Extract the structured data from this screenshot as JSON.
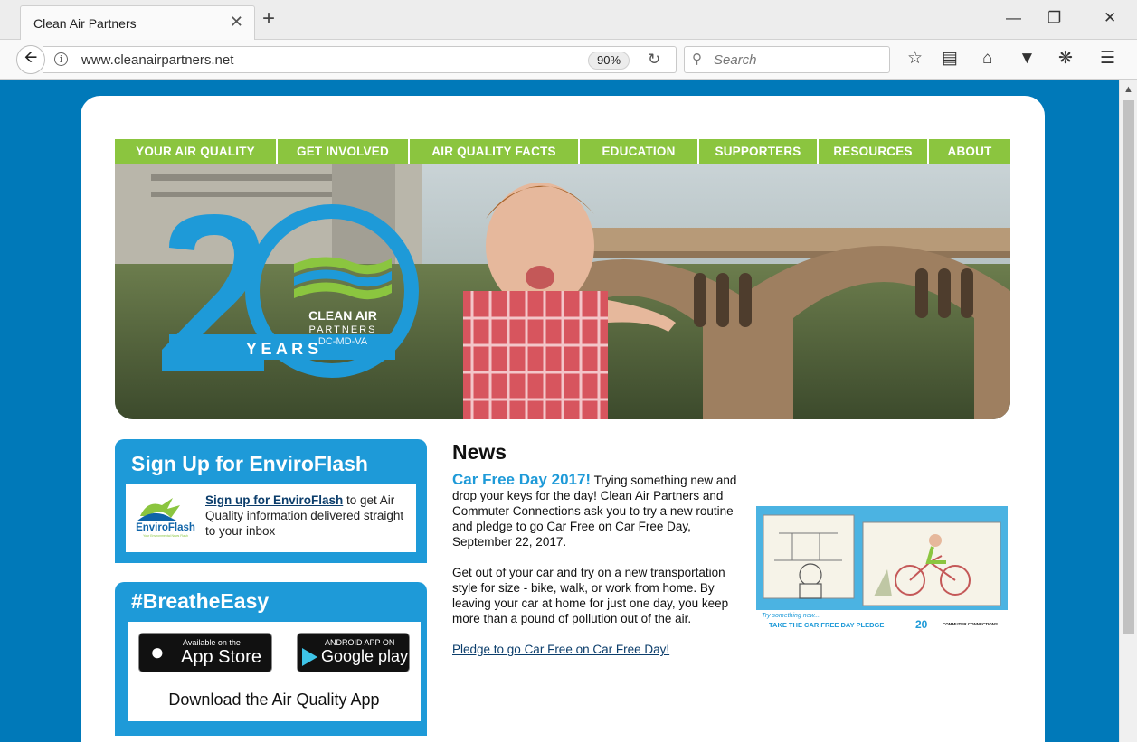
{
  "browser": {
    "tab_title": "Clean Air Partners",
    "tab_close": "✕",
    "new_tab": "+",
    "url": "www.cleanairpartners.net",
    "zoom": "90%",
    "search_placeholder": "Search",
    "window_controls": [
      "minimize",
      "restore",
      "close"
    ]
  },
  "site": {
    "nav": [
      "YOUR AIR QUALITY",
      "GET INVOLVED",
      "AIR QUALITY FACTS",
      "EDUCATION",
      "SUPPORTERS",
      "RESOURCES",
      "ABOUT"
    ],
    "hero": {
      "number": "20",
      "years": "Y E A R S",
      "org_line1": "CLEAN AIR",
      "org_line2": "PARTNERS",
      "org_line3": "DC-MD-VA"
    },
    "enviroflash": {
      "title": "Sign Up for EnviroFlash",
      "logo_text": "EnviroFlash",
      "logo_tagline": "Your Environmental News Flash",
      "link": "Sign up for EnviroFlash",
      "text": " to get Air Quality information delivered straight to your inbox"
    },
    "breathe": {
      "title": "#BreatheEasy",
      "appstore_small": "Available on the",
      "appstore_big": "App Store",
      "play_small": "ANDROID APP ON",
      "play_big": "Google play",
      "download": "Download the Air Quality App"
    },
    "news": {
      "heading": "News",
      "headline": "Car Free Day 2017!",
      "para1": " Trying something new and drop your keys for the day! Clean Air Partners and Commuter Connections ask you to try a new routine and pledge to go Car Free on Car Free Day, September 22, 2017.",
      "para2": "Get out of your car and try on a new transportation style for size - bike, walk, or work from home. By leaving your car at home for just one day, you keep more than a pound of pollution out of the air.",
      "link": "Pledge to go Car Free on Car Free Day!",
      "image": {
        "try_text": "Try something new...",
        "pledge_text": "TAKE THE CAR FREE DAY PLEDGE",
        "logo_20": "20",
        "partner": "COMMUTER CONNECTIONS"
      }
    }
  }
}
